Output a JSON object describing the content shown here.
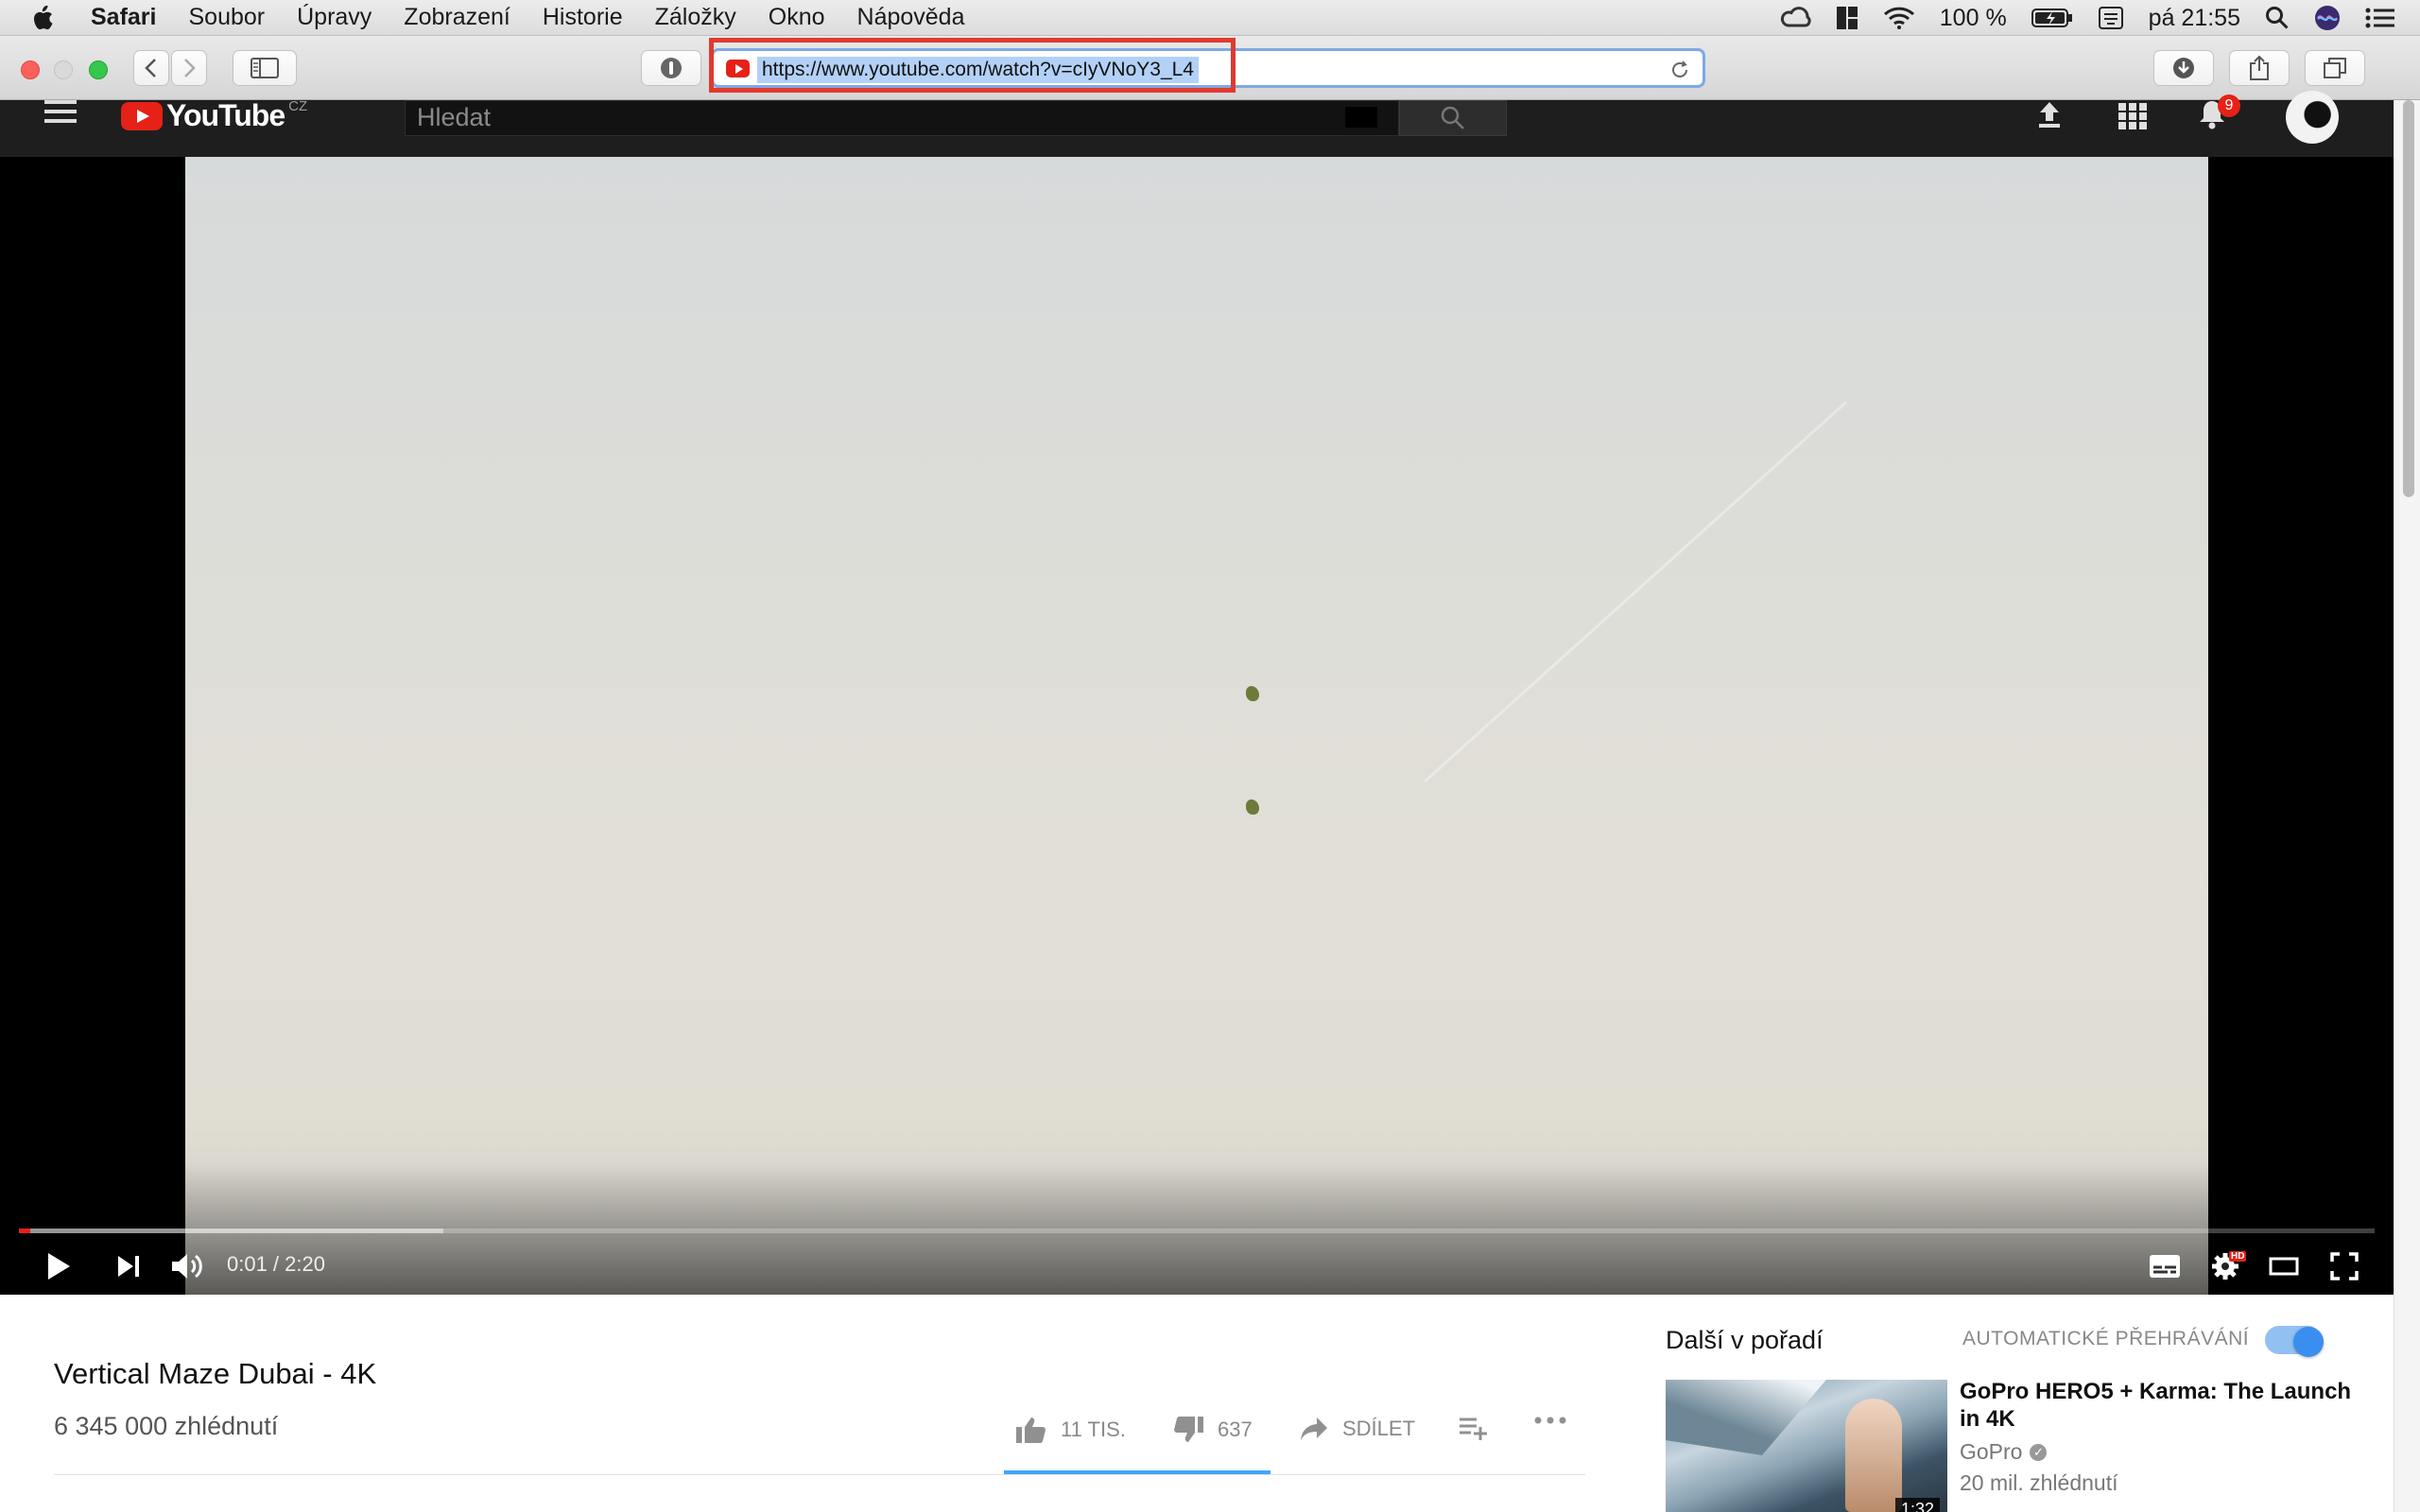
{
  "menubar": {
    "app_name": "Safari",
    "items": [
      "Soubor",
      "Úpravy",
      "Zobrazení",
      "Historie",
      "Záložky",
      "Okno",
      "Nápověda"
    ],
    "battery": "100 %",
    "clock": "pá 21:55",
    "status_icons": [
      "creative-cloud-icon",
      "dashboard-icon",
      "wifi-icon",
      "battery-icon",
      "keyboard-icon",
      "spotlight-icon",
      "siri-icon",
      "notification-center-icon"
    ]
  },
  "safari": {
    "url": "https://www.youtube.com/watch?v=cIyVNoY3_L4",
    "new_tab": "+"
  },
  "youtube": {
    "logo_text": "YouTube",
    "country": "CZ",
    "search_placeholder": "Hledat",
    "notification_count": "9"
  },
  "player": {
    "time": "0:01 / 2:20",
    "played_fraction": 0.005,
    "buffered_fraction": 0.18,
    "hd_badge": "HD"
  },
  "video": {
    "title": "Vertical Maze Dubai - 4K",
    "views": "6 345 000 zhlédnutí",
    "likes": "11 TIS.",
    "dislikes": "637",
    "share": "SDÍLET",
    "like_fraction": 0.95
  },
  "sidebar": {
    "up_next": "Další v pořadí",
    "autoplay_label": "AUTOMATICKÉ PŘEHRÁVÁNÍ",
    "autoplay_on": true,
    "rec": {
      "title": "GoPro HERO5 + Karma: The Launch in 4K",
      "channel": "GoPro",
      "views": "20 mil. zhlédnutí",
      "duration": "1:32"
    }
  },
  "colors": {
    "accent_red": "#e62117",
    "highlight_box": "#e03a2f",
    "address_focus": "#7fa8e6",
    "link_blue": "#3ea6ff"
  }
}
